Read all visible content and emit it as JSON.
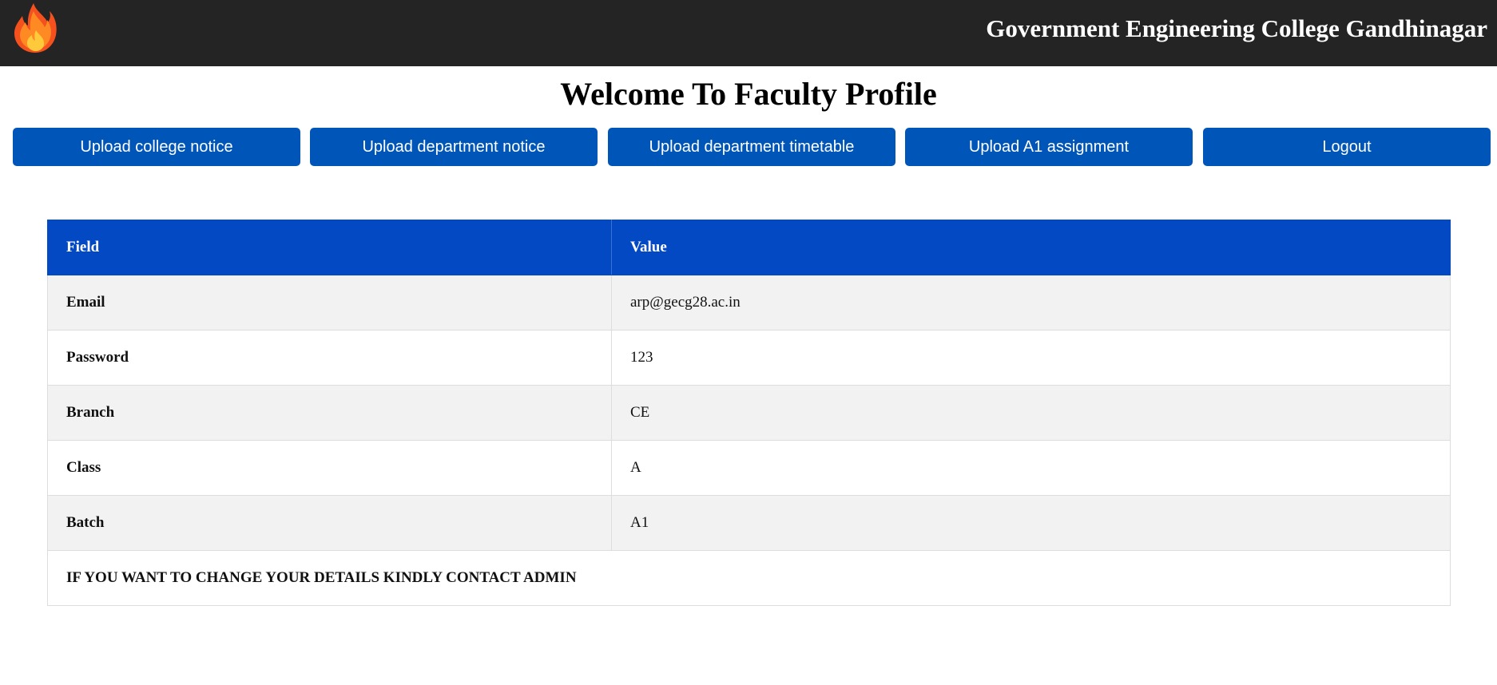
{
  "header": {
    "logo_icon": "fire-icon",
    "college_name": "Government Engineering College Gandhinagar",
    "background_color": "#242424"
  },
  "main": {
    "title": "Welcome To Faculty Profile"
  },
  "actions": [
    {
      "label": "Upload college notice"
    },
    {
      "label": "Upload department notice"
    },
    {
      "label": "Upload department timetable"
    },
    {
      "label": "Upload A1 assignment"
    },
    {
      "label": "Logout"
    }
  ],
  "accent_color": "#0056b8",
  "table": {
    "header_color": "#0449c4",
    "columns": [
      "Field",
      "Value"
    ],
    "rows": [
      {
        "field": "Email",
        "value": "arp@gecg28.ac.in"
      },
      {
        "field": "Password",
        "value": "123"
      },
      {
        "field": "Branch",
        "value": "CE"
      },
      {
        "field": "Class",
        "value": "A"
      },
      {
        "field": "Batch",
        "value": "A1"
      }
    ],
    "notice": "IF YOU WANT TO CHANGE YOUR DETAILS KINDLY CONTACT ADMIN"
  }
}
